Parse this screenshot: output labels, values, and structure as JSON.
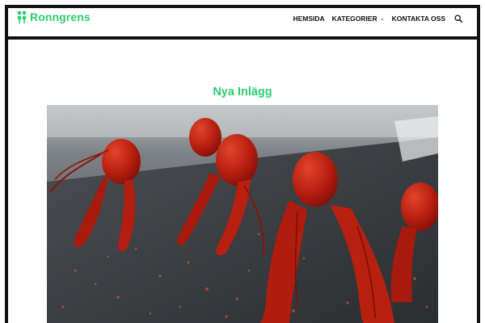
{
  "brand": {
    "name": "Ronngrens",
    "accent": "#2ecc71"
  },
  "nav": {
    "items": [
      {
        "label": "HEMSIDA",
        "has_dropdown": false
      },
      {
        "label": "KATEGORIER",
        "has_dropdown": true
      },
      {
        "label": "KONTAKTA OSS",
        "has_dropdown": false
      }
    ],
    "search_icon": "search-icon"
  },
  "main": {
    "section_title": "Nya Inlägg",
    "hero_image": "crayfish-on-slate-photo"
  },
  "colors": {
    "frame": "#111111",
    "title": "#2ecc71"
  }
}
